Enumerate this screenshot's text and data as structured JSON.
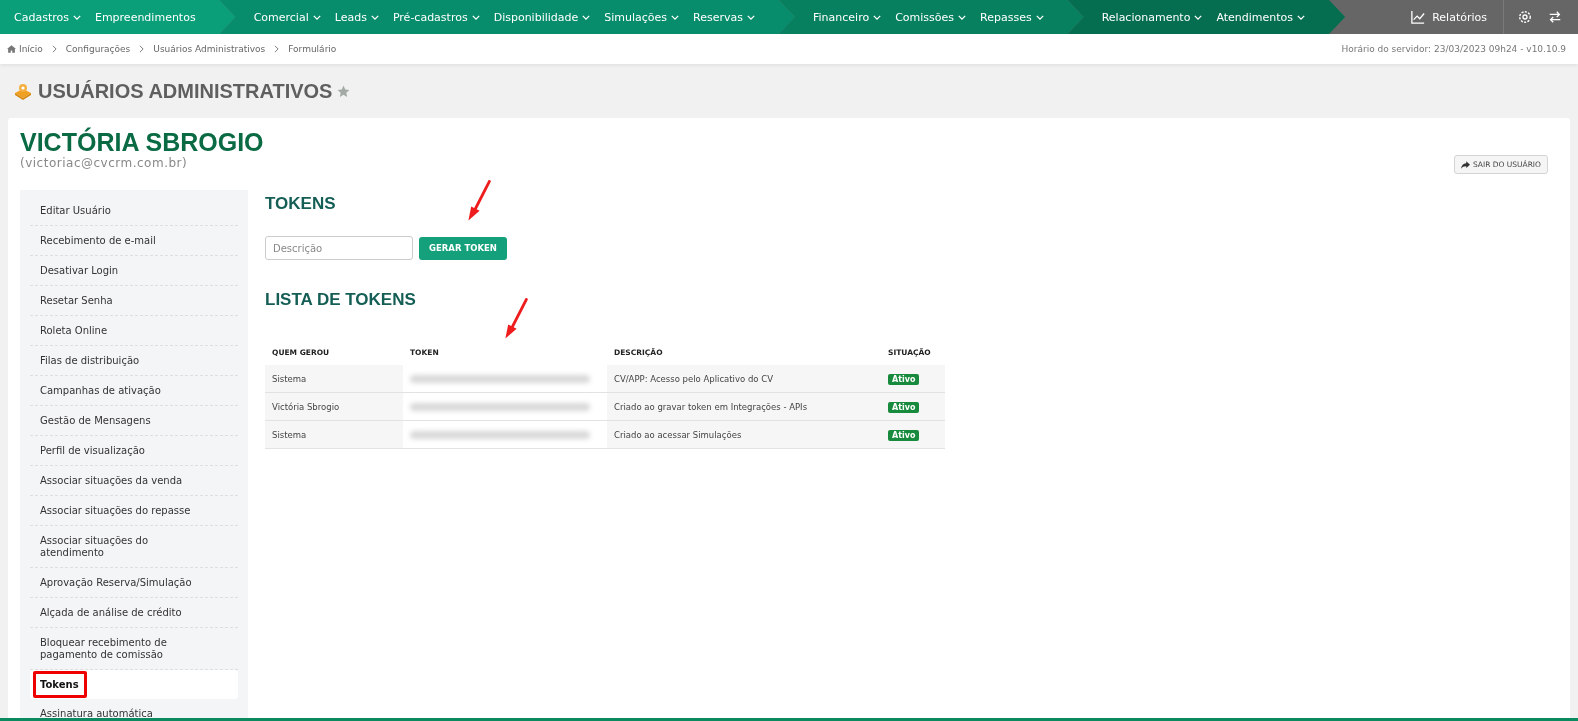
{
  "nav": {
    "groups": [
      {
        "items": [
          {
            "label": "Cadastros",
            "dropdown": true
          },
          {
            "label": "Empreendimentos",
            "dropdown": false
          }
        ]
      },
      {
        "items": [
          {
            "label": "Comercial",
            "dropdown": true
          },
          {
            "label": "Leads",
            "dropdown": true
          },
          {
            "label": "Pré-cadastros",
            "dropdown": true
          },
          {
            "label": "Disponibilidade",
            "dropdown": true
          },
          {
            "label": "Simulações",
            "dropdown": true
          },
          {
            "label": "Reservas",
            "dropdown": true
          }
        ]
      },
      {
        "items": [
          {
            "label": "Financeiro",
            "dropdown": true
          },
          {
            "label": "Comissões",
            "dropdown": true
          },
          {
            "label": "Repasses",
            "dropdown": true
          }
        ]
      },
      {
        "items": [
          {
            "label": "Relacionamento",
            "dropdown": true
          },
          {
            "label": "Atendimentos",
            "dropdown": true
          }
        ]
      }
    ],
    "reports": "Relatórios"
  },
  "breadcrumb": [
    "Início",
    "Configurações",
    "Usuários Administrativos",
    "Formulário"
  ],
  "server_time": "Horário do servidor: 23/03/2023 09h24 - v10.10.9",
  "page_title": "USUÁRIOS ADMINISTRATIVOS",
  "favorite": false,
  "user": {
    "name": "VICTÓRIA SBROGIO",
    "email": "(victoriac@cvcrm.com.br)"
  },
  "logout_button": "SAIR DO USUÁRIO",
  "sidebar": {
    "items": [
      {
        "label": "Editar Usuário",
        "selected": false,
        "highlighted": false
      },
      {
        "label": "Recebimento de e-mail",
        "selected": false,
        "highlighted": false
      },
      {
        "label": "Desativar Login",
        "selected": false,
        "highlighted": false
      },
      {
        "label": "Resetar Senha",
        "selected": false,
        "highlighted": false
      },
      {
        "label": "Roleta Online",
        "selected": false,
        "highlighted": false
      },
      {
        "label": "Filas de distribuição",
        "selected": false,
        "highlighted": false
      },
      {
        "label": "Campanhas de ativação",
        "selected": false,
        "highlighted": false
      },
      {
        "label": "Gestão de Mensagens",
        "selected": false,
        "highlighted": false
      },
      {
        "label": "Perfil de visualização",
        "selected": false,
        "highlighted": false
      },
      {
        "label": "Associar situações da venda",
        "selected": false,
        "highlighted": false
      },
      {
        "label": "Associar situações do repasse",
        "selected": false,
        "highlighted": false
      },
      {
        "label": "Associar situações do atendimento",
        "selected": false,
        "highlighted": false
      },
      {
        "label": "Aprovação Reserva/Simulação",
        "selected": false,
        "highlighted": false
      },
      {
        "label": "Alçada de análise de crédito",
        "selected": false,
        "highlighted": false
      },
      {
        "label": "Bloquear recebimento de pagamento de comissão",
        "selected": false,
        "highlighted": false
      },
      {
        "label": "Tokens",
        "selected": true,
        "highlighted": true
      },
      {
        "label": "Assinatura automática",
        "selected": false,
        "highlighted": false
      }
    ]
  },
  "tokens": {
    "title": "TOKENS",
    "description_field": {
      "placeholder": "Descrição"
    },
    "generate_button": {
      "label": "GERAR TOKEN",
      "arrow": true
    }
  },
  "token_list": {
    "title": "LISTA DE TOKENS",
    "columns": [
      {
        "label": "QUEM GEROU",
        "arrow": false
      },
      {
        "label": "TOKEN",
        "arrow": true
      },
      {
        "label": "DESCRIÇÃO",
        "arrow": false
      },
      {
        "label": "SITUAÇÃO",
        "arrow": false
      }
    ],
    "rows": [
      {
        "created_by": "Sistema",
        "description": "CV/APP: Acesso pelo Aplicativo do CV",
        "status": "Ativo",
        "active": true
      },
      {
        "created_by": "Victória Sbrogio",
        "description": "Criado ao gravar token em Integrações - APIs",
        "status": "Ativo",
        "active": true
      },
      {
        "created_by": "Sistema",
        "description": "Criado ao acessar Simulações",
        "status": "Ativo",
        "active": true
      }
    ]
  }
}
